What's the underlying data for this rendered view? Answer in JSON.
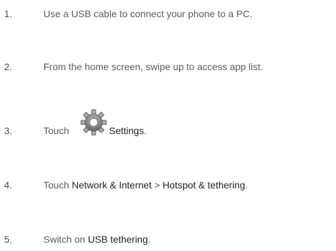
{
  "steps": [
    {
      "number": "1.",
      "text": "Use a USB cable to connect your phone to a PC."
    },
    {
      "number": "2.",
      "text": "From the home screen, swipe up to access app list."
    },
    {
      "number": "3.",
      "prefix": "Touch",
      "icon": "settings-gear-icon",
      "label": "Settings",
      "suffix": "."
    },
    {
      "number": "4.",
      "prefix": "Touch",
      "part1": "Network & Internet",
      "separator": ">",
      "part2": "Hotspot & tethering",
      "suffix": "."
    },
    {
      "number": "5.",
      "prefix": "Switch on",
      "label": "USB tethering",
      "suffix": "."
    }
  ],
  "colors": {
    "text": "#5a5a5a",
    "emphasis": "#222222",
    "gear": "#8a8a8a"
  }
}
